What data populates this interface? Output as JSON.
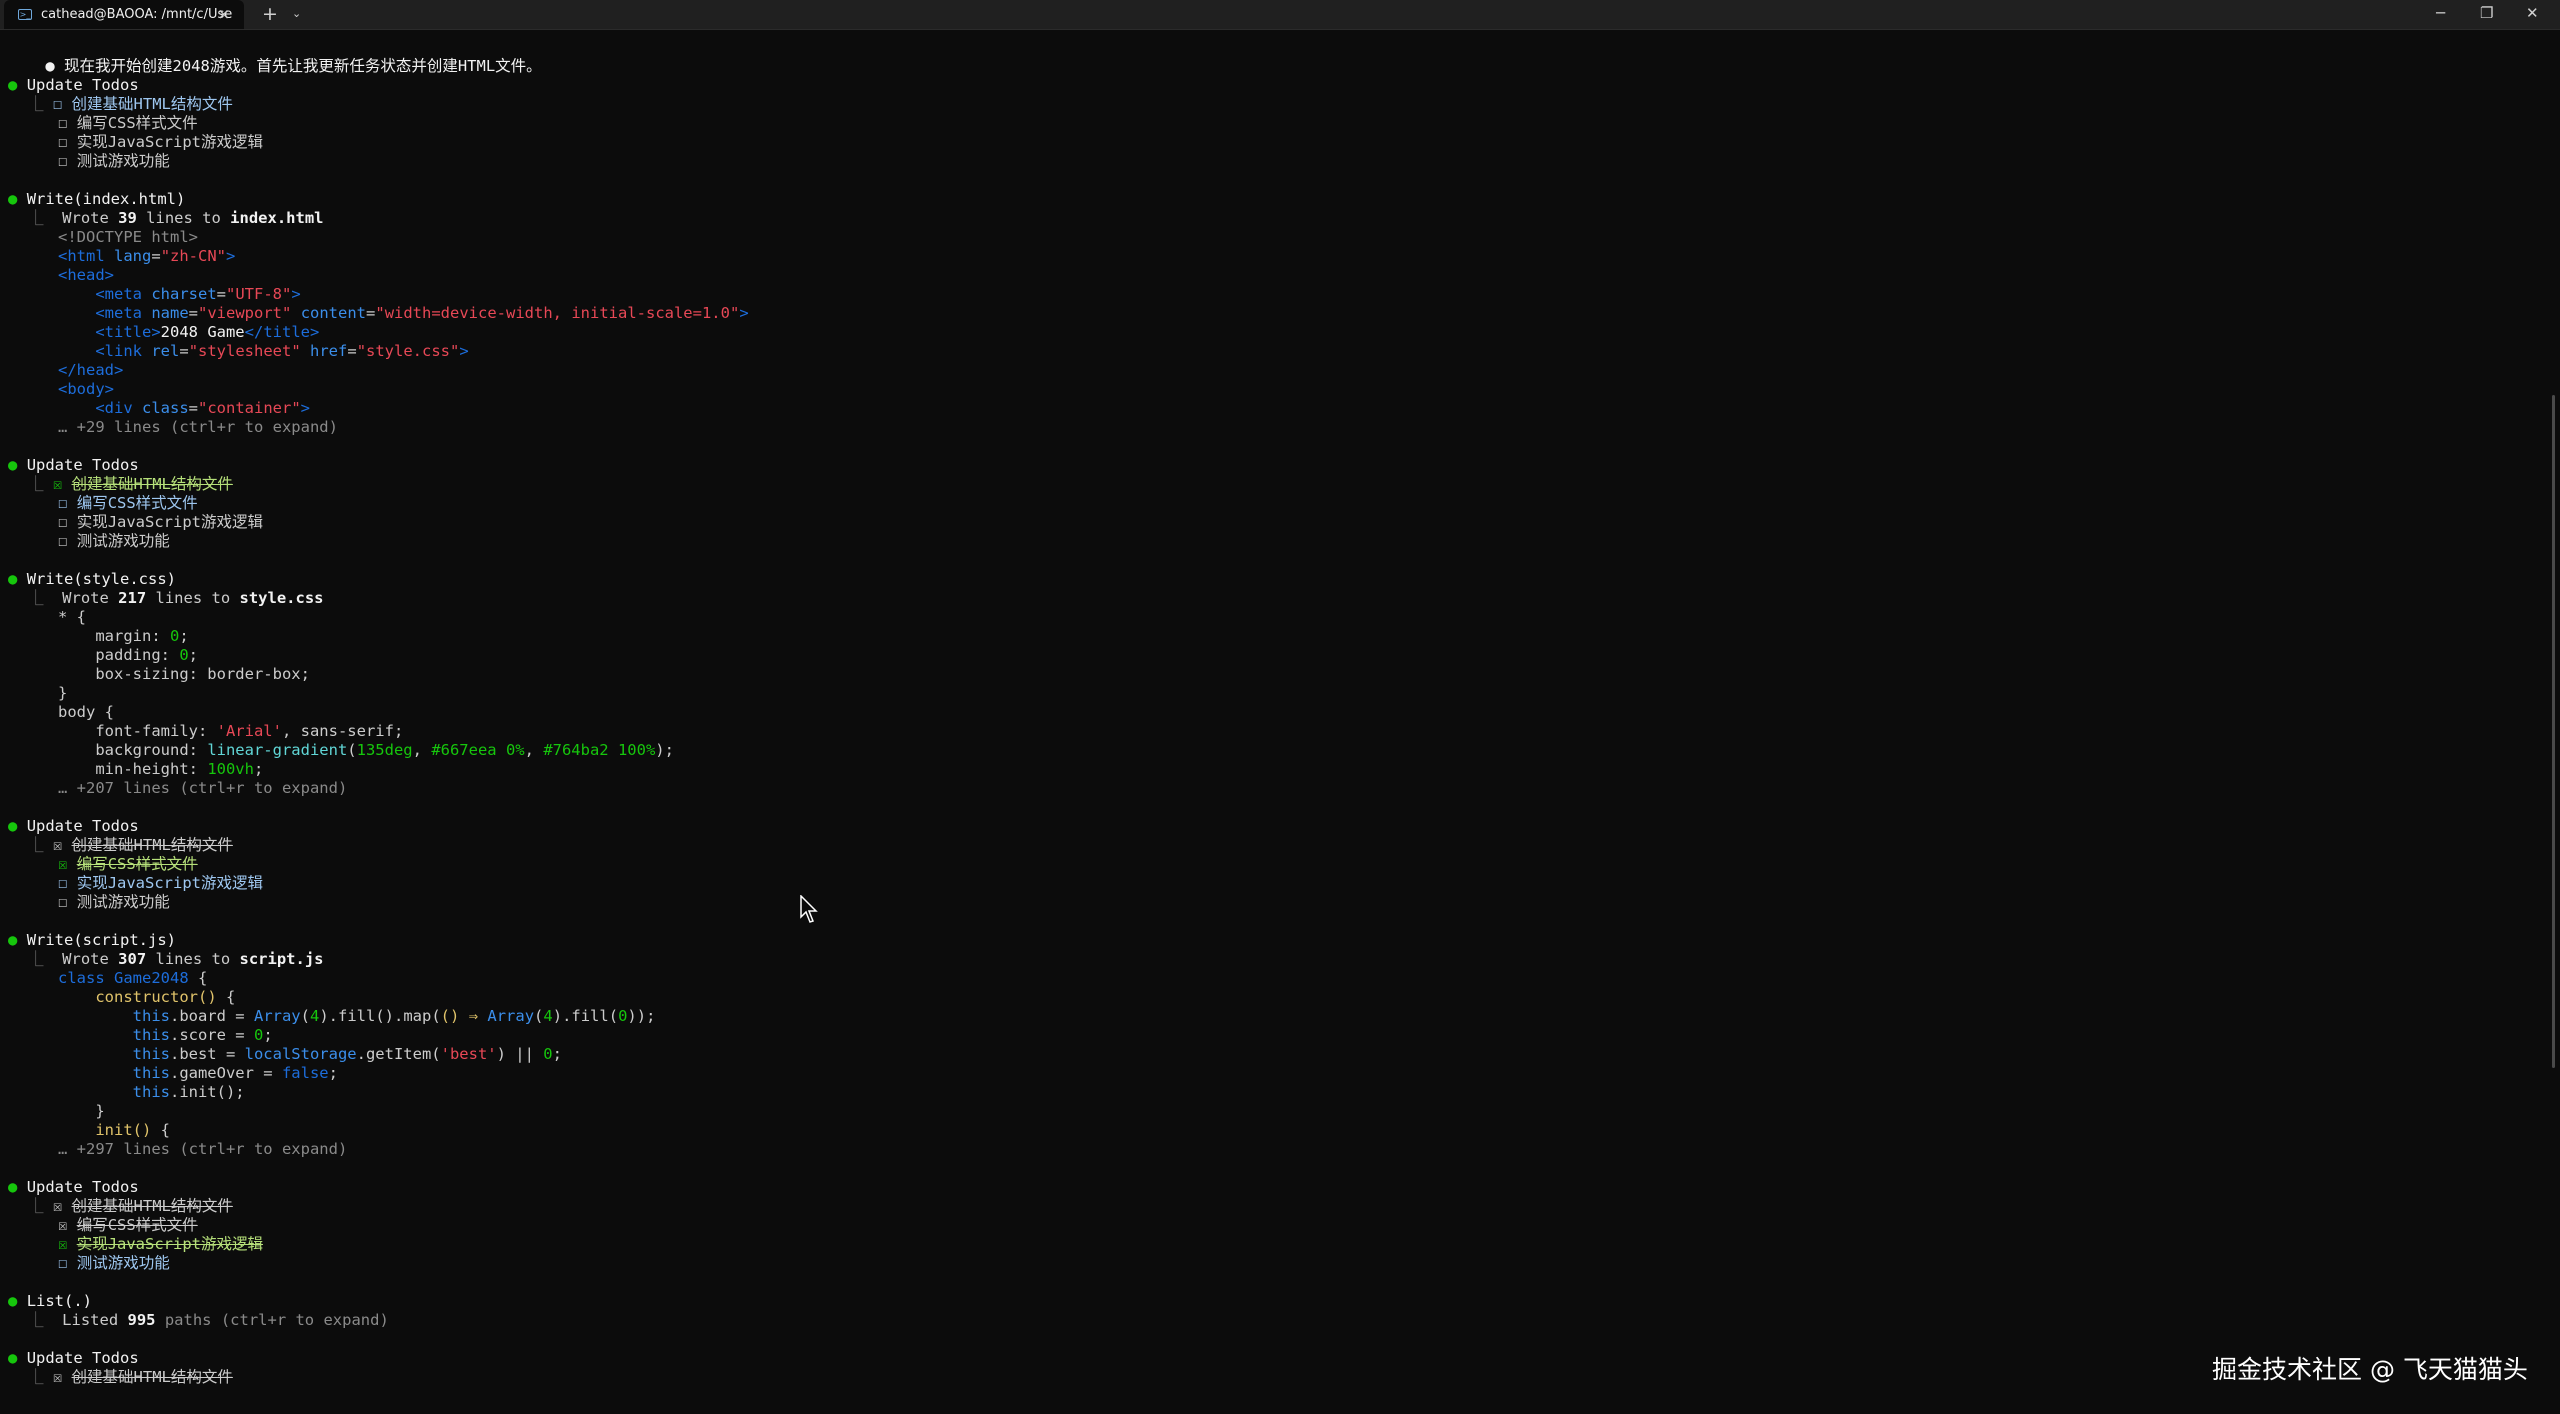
{
  "window": {
    "tab_title": "cathead@BAOOA: /mnt/c/Use",
    "tab_icon": "terminal-icon",
    "new_tab": "+",
    "dropdown": "⌄",
    "close_tab": "×",
    "minimize": "─",
    "maximize": "❐",
    "close": "✕"
  },
  "intro": "现在我开始创建2048游戏。首先让我更新任务状态并创建HTML文件。",
  "todos": {
    "title": "Update Todos",
    "items": [
      "创建基础HTML结构文件",
      "编写CSS样式文件",
      "实现JavaScript游戏逻辑",
      "测试游戏功能"
    ],
    "unchecked": "☐",
    "checked": "☒"
  },
  "write_html": {
    "title": "Write(index.html)",
    "wrote_prefix": "Wrote ",
    "count": "39",
    "mid": " lines to ",
    "file": "index.html",
    "expand": "… +29 lines (ctrl+r to expand)",
    "code": [
      "<!DOCTYPE html>",
      "<html lang=\"zh-CN\">",
      "<head>",
      "<meta charset=\"UTF-8\">",
      "<meta name=\"viewport\" content=\"width=device-width, initial-scale=1.0\">",
      "<title>2048 Game</title>",
      "<link rel=\"stylesheet\" href=\"style.css\">",
      "</head>",
      "<body>",
      "<div class=\"container\">"
    ]
  },
  "write_css": {
    "title": "Write(style.css)",
    "wrote_prefix": "Wrote ",
    "count": "217",
    "mid": " lines to ",
    "file": "style.css",
    "expand": "… +207 lines (ctrl+r to expand)",
    "code": [
      "* {",
      "margin: 0;",
      "padding: 0;",
      "box-sizing: border-box;",
      "}",
      "body {",
      "font-family: 'Arial', sans-serif;",
      "background: linear-gradient(135deg, #667eea 0%, #764ba2 100%);",
      "min-height: 100vh;"
    ]
  },
  "write_js": {
    "title": "Write(script.js)",
    "wrote_prefix": "Wrote ",
    "count": "307",
    "mid": " lines to ",
    "file": "script.js",
    "expand": "… +297 lines (ctrl+r to expand)",
    "code": [
      "class Game2048 {",
      "constructor() {",
      "this.board = Array(4).fill().map(() => Array(4).fill(0));",
      "this.score = 0;",
      "this.best = localStorage.getItem('best') || 0;",
      "this.gameOver = false;",
      "this.init();",
      "}",
      "init() {"
    ]
  },
  "list": {
    "title": "List(.)",
    "prefix": "Listed ",
    "count": "995",
    "suffix": " paths (ctrl+r to expand)"
  },
  "watermark": "掘金技术社区 @ 飞天猫猫头",
  "colors": {
    "background": "#0c0c0c",
    "bullet": "#16c60c",
    "tag": "#1d6ddb",
    "string": "#e74856",
    "number": "#16c60c",
    "todo_active": "#9ec7f0",
    "todo_done": "#b6e07a"
  }
}
